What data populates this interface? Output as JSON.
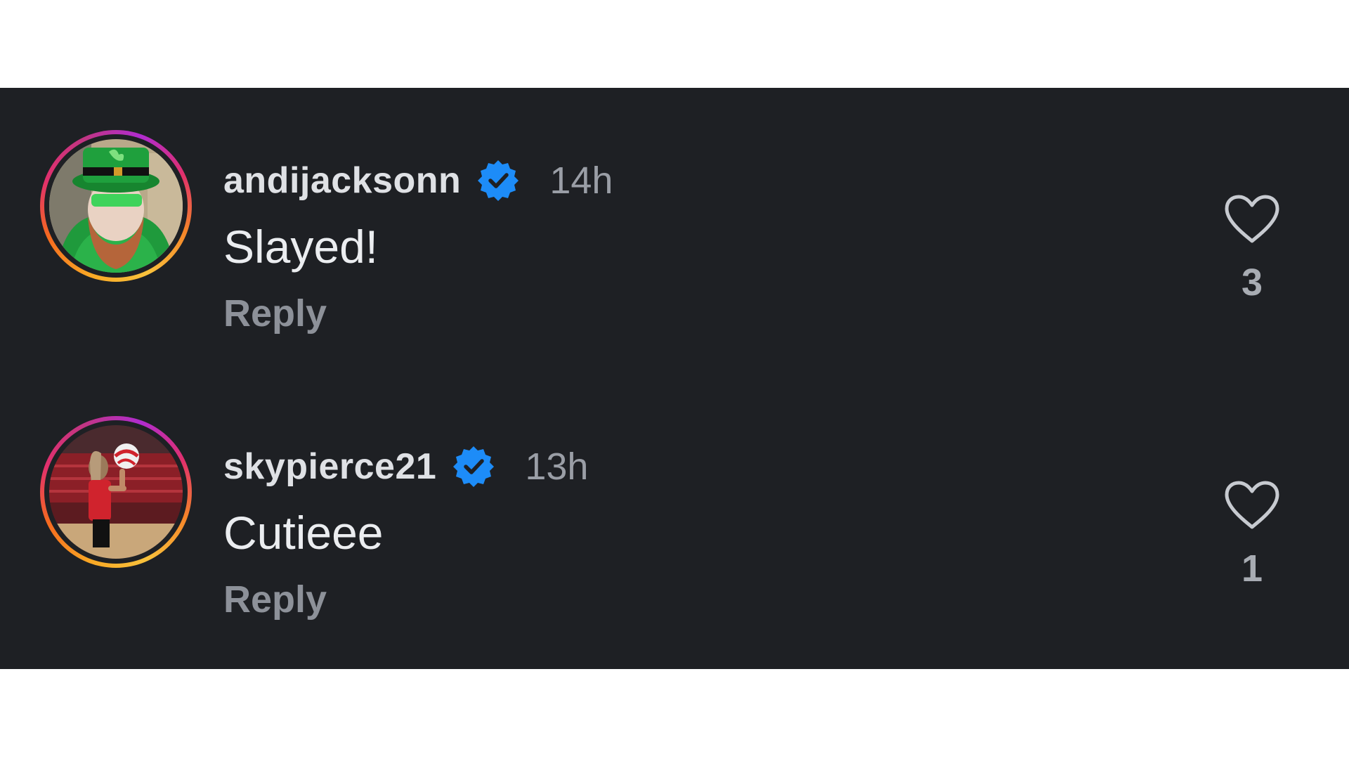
{
  "colors": {
    "panel_background": "#1e2024",
    "username": "#dfe1e5",
    "timestamp": "#9a9ea6",
    "comment_text": "#ebedf0",
    "reply": "#8d9199",
    "verified_badge": "#1d8cf8"
  },
  "comments": [
    {
      "username": "andijacksonn",
      "verified": true,
      "timestamp": "14h",
      "text": "Slayed!",
      "reply_label": "Reply",
      "like_count": "3",
      "avatar_icon": "leprechaun-avatar",
      "like_icon": "heart-outline-icon"
    },
    {
      "username": "skypierce21",
      "verified": true,
      "timestamp": "13h",
      "text": "Cutieee",
      "reply_label": "Reply",
      "like_count": "1",
      "avatar_icon": "volleyball-player-avatar",
      "like_icon": "heart-outline-icon"
    }
  ]
}
